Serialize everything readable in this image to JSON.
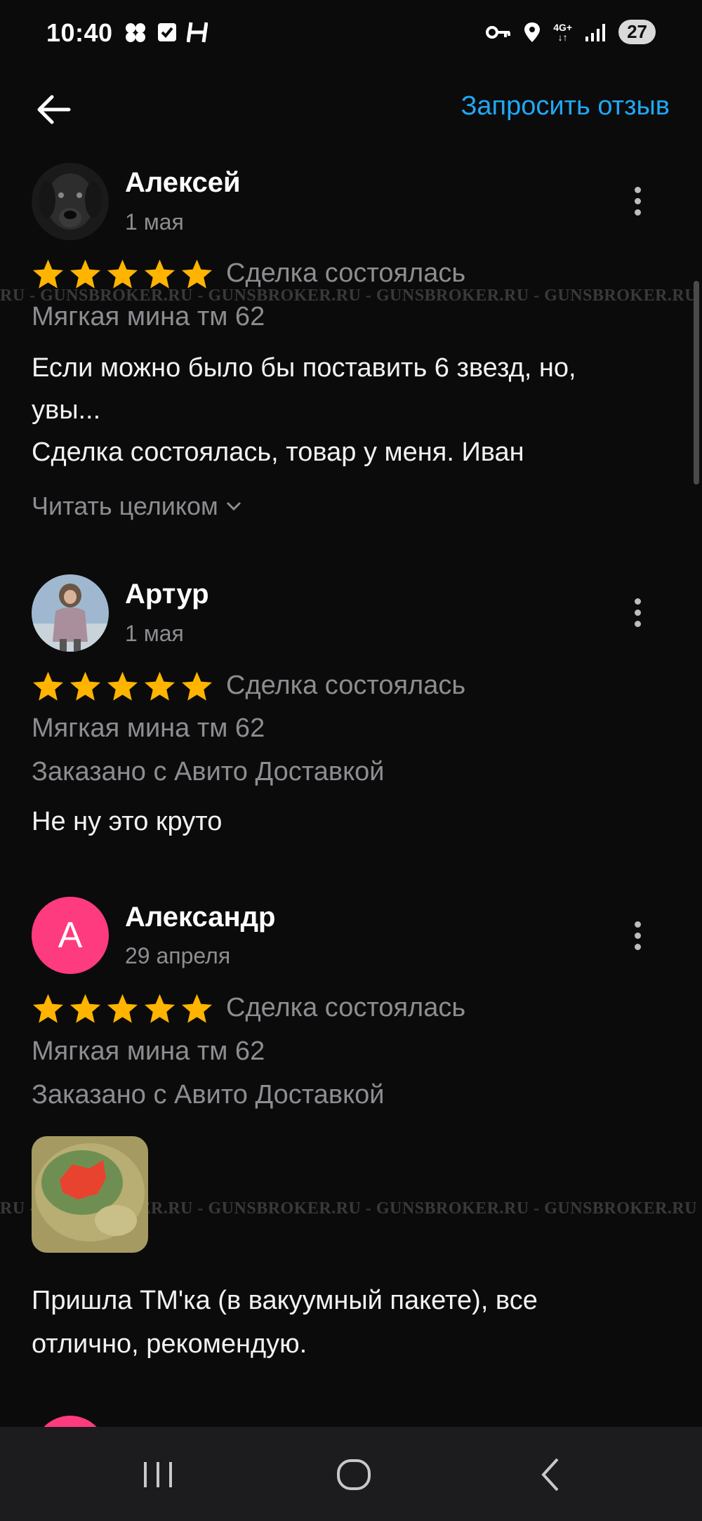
{
  "status_bar": {
    "time": "10:40",
    "network": "4G+",
    "battery": "27"
  },
  "header": {
    "back_icon": "arrow-left-icon",
    "request_review": "Запросить отзыв"
  },
  "reviews": [
    {
      "name": "Алексей",
      "date": "1 мая",
      "rating": 5,
      "deal_status": "Сделка состоялась",
      "item": "Мягкая мина тм 62",
      "text_line1": "Если можно было бы поставить 6 звезд, но,",
      "text_line2": "увы...",
      "text_line3": "Сделка состоялась, товар у меня. Иван",
      "read_more": "Читать целиком"
    },
    {
      "name": "Артур",
      "date": "1 мая",
      "rating": 5,
      "deal_status": "Сделка состоялась",
      "item": "Мягкая мина тм 62",
      "delivery": "Заказано с Авито Доставкой",
      "text": "Не ну это круто"
    },
    {
      "name": "Александр",
      "avatar_letter": "А",
      "date": "29 апреля",
      "rating": 5,
      "deal_status": "Сделка состоялась",
      "item": "Мягкая мина тм 62",
      "delivery": "Заказано с Авито Доставкой",
      "text_line1": "Пришла ТМ'ка (в вакуумный  пакете), все",
      "text_line2": "отлично,  рекомендую."
    }
  ],
  "watermark": "RU - GUNSBROKER.RU - GUNSBROKER.RU - GUNSBROKER.RU - GUNSBROKER.RU - GUNSBROKER.RU",
  "colors": {
    "background": "#0b0b0c",
    "accent": "#1fa8f5",
    "star": "#ffb400",
    "avatar_pink": "#ff3b7f"
  }
}
